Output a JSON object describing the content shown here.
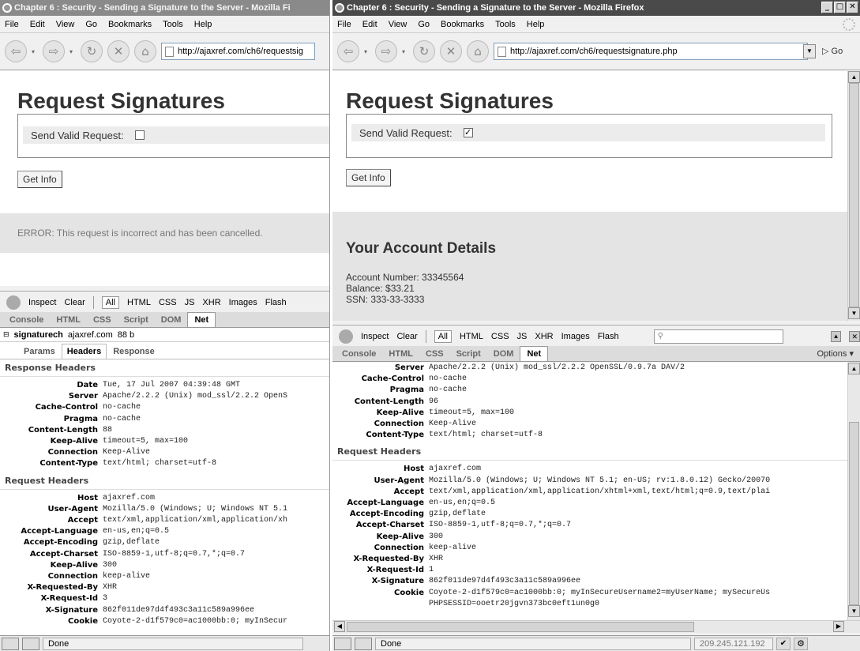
{
  "left": {
    "title": "Chapter 6 : Security - Sending a Signature to the Server - Mozilla Fi",
    "menu": [
      "File",
      "Edit",
      "View",
      "Go",
      "Bookmarks",
      "Tools",
      "Help"
    ],
    "url": "http://ajaxref.com/ch6/requestsig",
    "heading": "Request Signatures",
    "checkbox_label": "Send Valid Request:",
    "get_info": "Get Info",
    "error": "ERROR: This request is incorrect and has been cancelled.",
    "fb_toolbar": [
      "Inspect",
      "Clear",
      "All",
      "HTML",
      "CSS",
      "JS",
      "XHR",
      "Images",
      "Flash"
    ],
    "fb_tabs": [
      "Console",
      "HTML",
      "CSS",
      "Script",
      "DOM",
      "Net"
    ],
    "req_name": "signaturech",
    "req_host": "ajaxref.com",
    "req_size": "88 b",
    "sub_tabs": [
      "Params",
      "Headers",
      "Response"
    ],
    "response_title": "Response Headers",
    "response_headers": [
      [
        "Date",
        "Tue, 17 Jul 2007 04:39:48 GMT"
      ],
      [
        "Server",
        "Apache/2.2.2 (Unix) mod_ssl/2.2.2 OpenS"
      ],
      [
        "Cache-Control",
        "no-cache"
      ],
      [
        "Pragma",
        "no-cache"
      ],
      [
        "Content-Length",
        "88"
      ],
      [
        "Keep-Alive",
        "timeout=5, max=100"
      ],
      [
        "Connection",
        "Keep-Alive"
      ],
      [
        "Content-Type",
        "text/html; charset=utf-8"
      ]
    ],
    "request_title": "Request Headers",
    "request_headers": [
      [
        "Host",
        "ajaxref.com"
      ],
      [
        "User-Agent",
        "Mozilla/5.0 (Windows; U; Windows NT 5.1"
      ],
      [
        "Accept",
        "text/xml,application/xml,application/xh"
      ],
      [
        "Accept-Language",
        "en-us,en;q=0.5"
      ],
      [
        "Accept-Encoding",
        "gzip,deflate"
      ],
      [
        "Accept-Charset",
        "ISO-8859-1,utf-8;q=0.7,*;q=0.7"
      ],
      [
        "Keep-Alive",
        "300"
      ],
      [
        "Connection",
        "keep-alive"
      ],
      [
        "X-Requested-By",
        "XHR"
      ],
      [
        "X-Request-Id",
        "3"
      ],
      [
        "X-Signature",
        "862f011de97d4f493c3a11c589a996ee"
      ],
      [
        "Cookie",
        "Coyote-2-d1f579c0=ac1000bb:0; myInSecur"
      ]
    ],
    "status": "Done"
  },
  "right": {
    "title": "Chapter 6 : Security - Sending a Signature to the Server - Mozilla Firefox",
    "menu": [
      "File",
      "Edit",
      "View",
      "Go",
      "Bookmarks",
      "Tools",
      "Help"
    ],
    "url": "http://ajaxref.com/ch6/requestsignature.php",
    "go": "Go",
    "heading": "Request Signatures",
    "checkbox_label": "Send Valid Request:",
    "get_info": "Get Info",
    "account_title": "Your Account Details",
    "account_lines": [
      "Account Number: 33345564",
      "Balance: $33.21",
      "SSN: 333-33-3333"
    ],
    "fb_toolbar": [
      "Inspect",
      "Clear",
      "All",
      "HTML",
      "CSS",
      "JS",
      "XHR",
      "Images",
      "Flash"
    ],
    "fb_tabs": [
      "Console",
      "HTML",
      "CSS",
      "Script",
      "DOM",
      "Net"
    ],
    "options": "Options ▾",
    "response_headers": [
      [
        "Server",
        "Apache/2.2.2 (Unix) mod_ssl/2.2.2 OpenSSL/0.9.7a DAV/2"
      ],
      [
        "Cache-Control",
        "no-cache"
      ],
      [
        "Pragma",
        "no-cache"
      ],
      [
        "Content-Length",
        "96"
      ],
      [
        "Keep-Alive",
        "timeout=5, max=100"
      ],
      [
        "Connection",
        "Keep-Alive"
      ],
      [
        "Content-Type",
        "text/html; charset=utf-8"
      ]
    ],
    "request_title": "Request Headers",
    "request_headers": [
      [
        "Host",
        "ajaxref.com"
      ],
      [
        "User-Agent",
        "Mozilla/5.0 (Windows; U; Windows NT 5.1; en-US; rv:1.8.0.12) Gecko/20070"
      ],
      [
        "Accept",
        "text/xml,application/xml,application/xhtml+xml,text/html;q=0.9,text/plai"
      ],
      [
        "Accept-Language",
        "en-us,en;q=0.5"
      ],
      [
        "Accept-Encoding",
        "gzip,deflate"
      ],
      [
        "Accept-Charset",
        "ISO-8859-1,utf-8;q=0.7,*;q=0.7"
      ],
      [
        "Keep-Alive",
        "300"
      ],
      [
        "Connection",
        "keep-alive"
      ],
      [
        "X-Requested-By",
        "XHR"
      ],
      [
        "X-Request-Id",
        "1"
      ],
      [
        "X-Signature",
        "862f011de97d4f493c3a11c589a996ee"
      ],
      [
        "Cookie",
        "Coyote-2-d1f579c0=ac1000bb:0; myInSecureUsername2=myUserName; mySecureUs"
      ],
      [
        "",
        "PHPSESSID=ooetr20jgvn373bc0eft1un0g0"
      ]
    ],
    "status": "Done",
    "ip": "209.245.121.192"
  }
}
